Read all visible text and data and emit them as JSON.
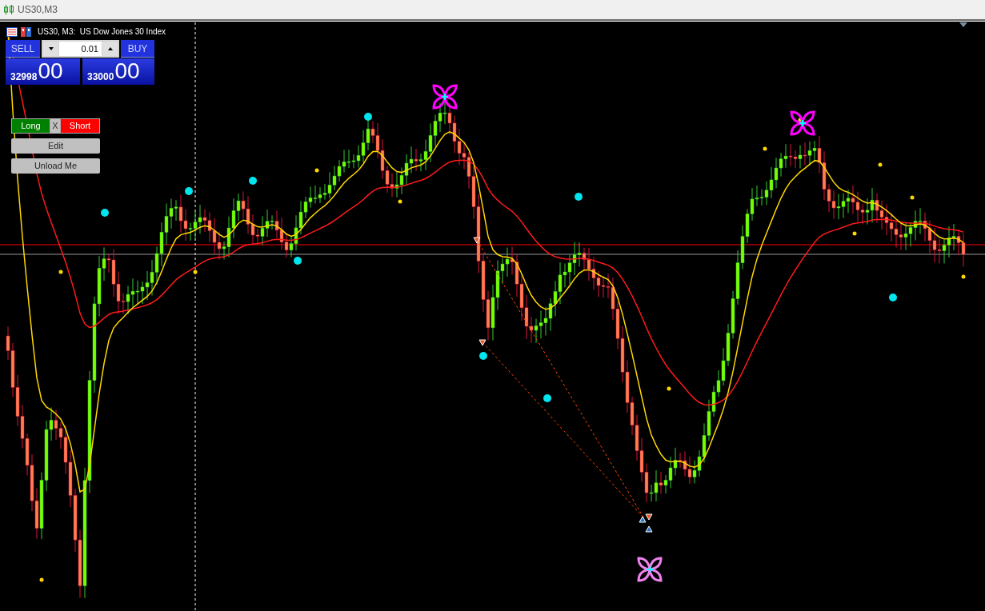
{
  "window": {
    "title": "US30,M3"
  },
  "chart": {
    "header": "US30, M3:  US Dow Jones 30 Index"
  },
  "trade_panel": {
    "sell_label": "SELL",
    "buy_label": "BUY",
    "lot": "0.01",
    "sell_price": "32998",
    "sell_price_big": "00",
    "buy_price": "33000",
    "buy_price_big": "00"
  },
  "controls": [
    {
      "kind": "split",
      "left": "Long",
      "middle": "X",
      "right": "Short"
    },
    {
      "kind": "button",
      "label": "Edit"
    },
    {
      "kind": "button",
      "label": "Unload Me"
    }
  ]
}
